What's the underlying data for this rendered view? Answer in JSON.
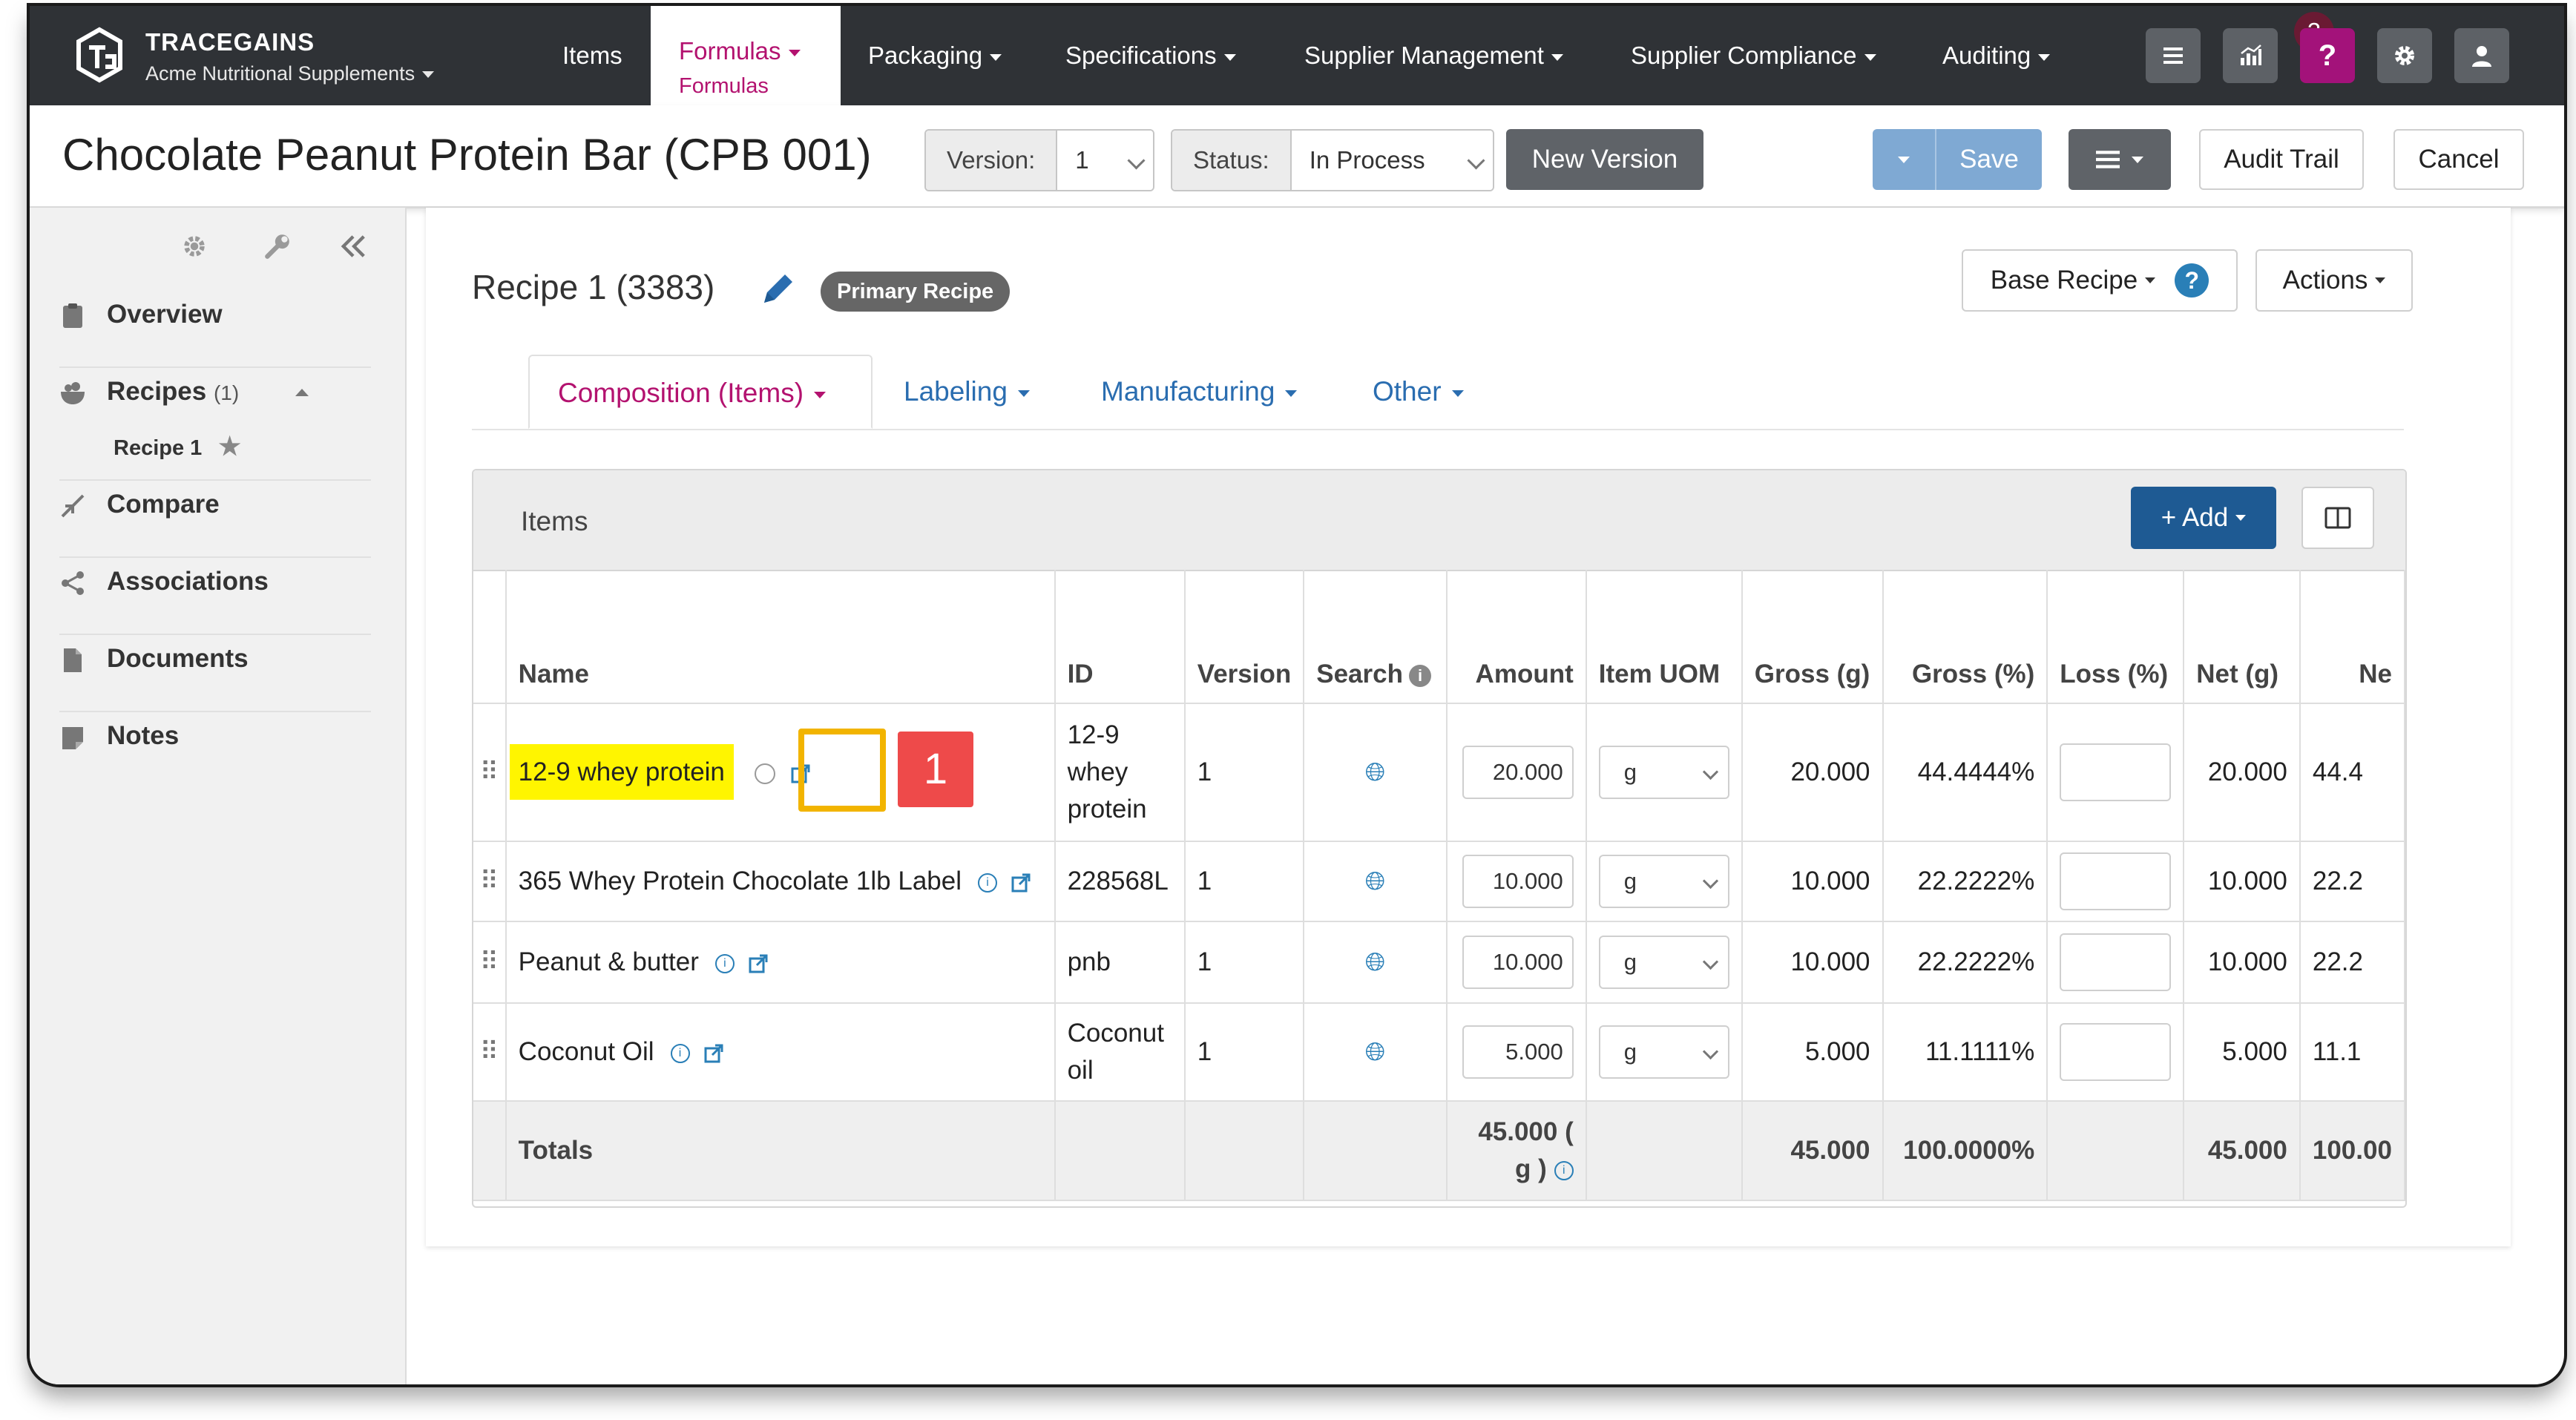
{
  "app": {
    "brand": "TRACEGAINS",
    "org": "Acme Nutritional Supplements",
    "nav": [
      {
        "label": "Items"
      },
      {
        "label": "Formulas",
        "sub": "Formulas"
      },
      {
        "label": "Packaging"
      },
      {
        "label": "Specifications"
      },
      {
        "label": "Supplier Management"
      },
      {
        "label": "Supplier Compliance"
      },
      {
        "label": "Auditing"
      }
    ],
    "notification_count": "3",
    "help_label": "?"
  },
  "header": {
    "title": "Chocolate Peanut Protein Bar (CPB 001)",
    "version_label": "Version:",
    "version_value": "1",
    "status_label": "Status:",
    "status_value": "In Process",
    "new_version": "New Version",
    "save": "Save",
    "audit_trail": "Audit Trail",
    "cancel": "Cancel"
  },
  "sidebar": {
    "items": [
      {
        "label": "Overview"
      },
      {
        "label": "Recipes",
        "count": "(1)"
      },
      {
        "label": "Compare"
      },
      {
        "label": "Associations"
      },
      {
        "label": "Documents"
      },
      {
        "label": "Notes"
      }
    ],
    "sub_item": "Recipe 1"
  },
  "recipe": {
    "title": "Recipe 1 (3383)",
    "badge": "Primary Recipe",
    "base_recipe": "Base Recipe",
    "actions": "Actions",
    "tabs": [
      {
        "label": "Composition (Items)"
      },
      {
        "label": "Labeling"
      },
      {
        "label": "Manufacturing"
      },
      {
        "label": "Other"
      }
    ]
  },
  "items_panel": {
    "title": "Items",
    "add": "+ Add",
    "columns": [
      "Name",
      "ID",
      "Version",
      "Search",
      "Amount",
      "Item UOM",
      "Gross (g)",
      "Gross (%)",
      "Loss (%)",
      "Net (g)",
      "Ne"
    ],
    "rows": [
      {
        "name": "12-9 whey protein",
        "id": "12-9 whey protein",
        "version": "1",
        "amount": "20.000",
        "uom": "g",
        "gross_g": "20.000",
        "gross_pct": "44.4444%",
        "net_g": "20.000",
        "net_pct": "44.4"
      },
      {
        "name": "365 Whey Protein Chocolate 1lb Label",
        "id": "228568L",
        "version": "1",
        "amount": "10.000",
        "uom": "g",
        "gross_g": "10.000",
        "gross_pct": "22.2222%",
        "net_g": "10.000",
        "net_pct": "22.2"
      },
      {
        "name": "Peanut & butter",
        "id": "pnb",
        "version": "1",
        "amount": "10.000",
        "uom": "g",
        "gross_g": "10.000",
        "gross_pct": "22.2222%",
        "net_g": "10.000",
        "net_pct": "22.2"
      },
      {
        "name": "Coconut Oil",
        "id": "Coconut oil",
        "version": "1",
        "amount": "5.000",
        "uom": "g",
        "gross_g": "5.000",
        "gross_pct": "11.1111%",
        "net_g": "5.000",
        "net_pct": "11.1"
      }
    ],
    "totals": {
      "label": "Totals",
      "amount": "45.000 ( g )",
      "gross_g": "45.000",
      "gross_pct": "100.0000%",
      "net_g": "45.000",
      "net_pct": "100.00"
    }
  },
  "callout": {
    "number": "1"
  },
  "colors": {
    "nav_bg": "#2f3236",
    "accent": "#b3126f",
    "link": "#2a6db0",
    "primary_btn": "#1e5a93",
    "highlight": "#fff500",
    "callout_border": "#f2b400",
    "callout_bg": "#ee4a4a"
  }
}
